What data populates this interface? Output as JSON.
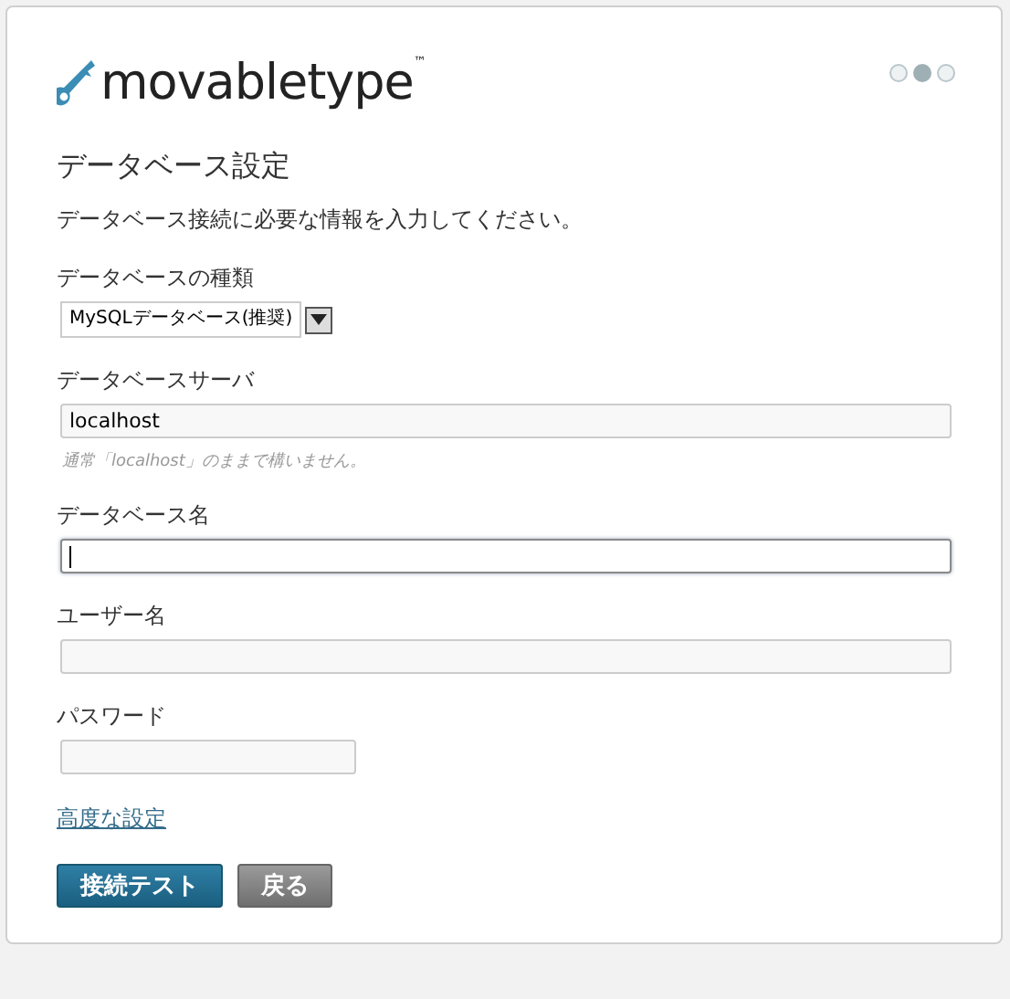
{
  "logo": {
    "text": "movabletype",
    "mark": "™"
  },
  "steps": [
    {
      "selected": false
    },
    {
      "selected": true
    },
    {
      "selected": false
    }
  ],
  "title": "データベース設定",
  "description": "データベース接続に必要な情報を入力してください。",
  "fields": [
    {
      "kind": "select",
      "label": "データベースの種類",
      "value": "MySQLデータベース(推奨)"
    },
    {
      "kind": "text",
      "label": "データベースサーバ",
      "value": "localhost",
      "hint": "通常「localhost」のままで構いません。",
      "focused": false
    },
    {
      "kind": "text",
      "label": "データベース名",
      "focused": true
    },
    {
      "kind": "text",
      "label": "ユーザー名",
      "focused": false
    },
    {
      "kind": "password",
      "label": "パスワード",
      "focused": false
    }
  ],
  "advanced_link": "高度な設定",
  "buttons": [
    {
      "kind": "primary",
      "label": "接続テスト"
    },
    {
      "kind": "secondary",
      "label": "戻る"
    }
  ]
}
